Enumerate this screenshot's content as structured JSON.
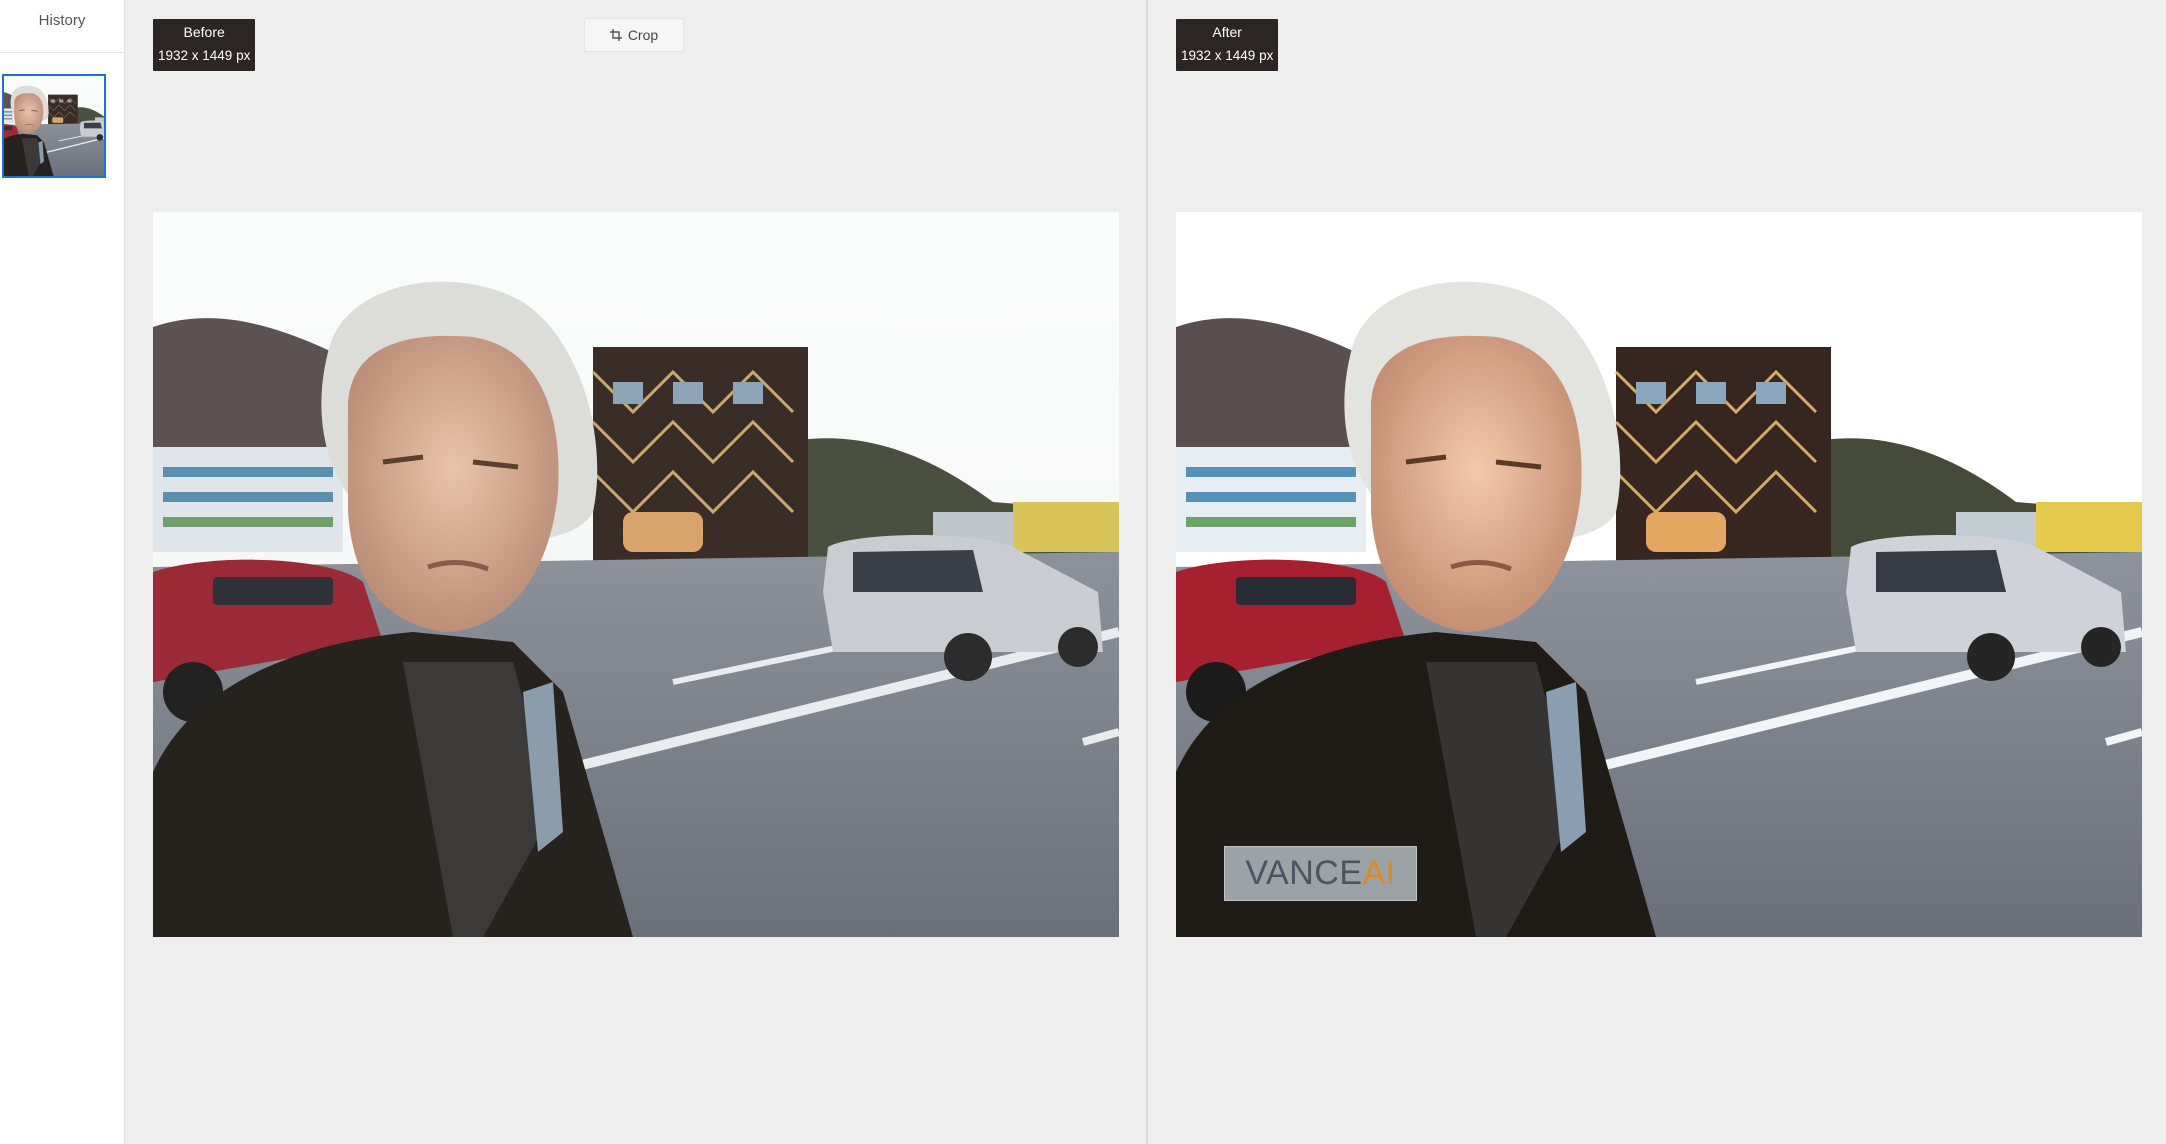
{
  "sidebar": {
    "title": "History",
    "items": [
      {
        "thumbnail": "portrait-street-thumbnail",
        "selected": true
      }
    ]
  },
  "before": {
    "label": "Before",
    "dimensions": "1932 x 1449 px"
  },
  "after": {
    "label": "After",
    "dimensions": "1932 x 1449 px",
    "watermark": {
      "part1": "VANCE",
      "part2": "AI"
    }
  },
  "toolbar": {
    "crop_label": "Crop",
    "crop_icon": "crop-icon"
  },
  "colors": {
    "accent": "#1f6fd1",
    "tag_background": "#2b2523",
    "watermark_accent": "#e08a1e",
    "canvas": "#eeeeee"
  }
}
